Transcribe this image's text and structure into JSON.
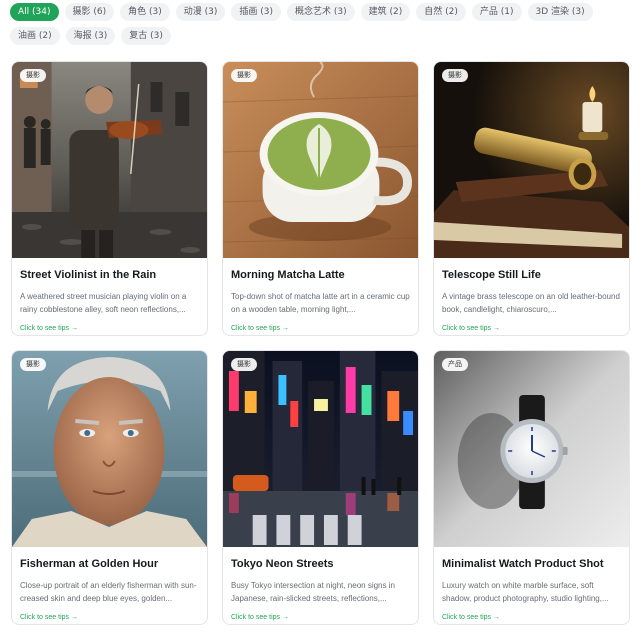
{
  "filters": [
    {
      "label": "All (34)",
      "active": true
    },
    {
      "label": "摄影 (6)"
    },
    {
      "label": "角色 (3)"
    },
    {
      "label": "动漫 (3)"
    },
    {
      "label": "插画 (3)"
    },
    {
      "label": "概念艺术 (3)"
    },
    {
      "label": "建筑 (2)"
    },
    {
      "label": "自然 (2)"
    },
    {
      "label": "产品 (1)"
    },
    {
      "label": "3D 渲染 (3)"
    },
    {
      "label": "油画 (2)"
    },
    {
      "label": "海报 (3)"
    },
    {
      "label": "复古 (3)"
    }
  ],
  "cards": [
    {
      "tag": "摄影",
      "title": "Street Violinist in the Rain",
      "desc": "A weathered street musician playing violin on a rainy cobblestone alley, soft neon reflections,...",
      "tips": "Click to see tips →"
    },
    {
      "tag": "摄影",
      "title": "Morning Matcha Latte",
      "desc": "Top-down shot of matcha latte art in a ceramic cup on a wooden table, morning light,...",
      "tips": "Click to see tips →"
    },
    {
      "tag": "摄影",
      "title": "Telescope Still Life",
      "desc": "A vintage brass telescope on an old leather-bound book, candlelight, chiaroscuro,...",
      "tips": "Click to see tips →"
    },
    {
      "tag": "摄影",
      "title": "Fisherman at Golden Hour",
      "desc": "Close-up portrait of an elderly fisherman with sun-creased skin and deep blue eyes, golden...",
      "tips": "Click to see tips →"
    },
    {
      "tag": "摄影",
      "title": "Tokyo Neon Streets",
      "desc": "Busy Tokyo intersection at night, neon signs in Japanese, rain-slicked streets, reflections,...",
      "tips": "Click to see tips →"
    },
    {
      "tag": "产品",
      "title": "Minimalist Watch Product Shot",
      "desc": "Luxury watch on white marble surface, soft shadow, product photography, studio lighting,...",
      "tips": "Click to see tips →"
    }
  ],
  "colors": {
    "accent": "#22a35a",
    "chip_bg": "#f1f2f4"
  }
}
